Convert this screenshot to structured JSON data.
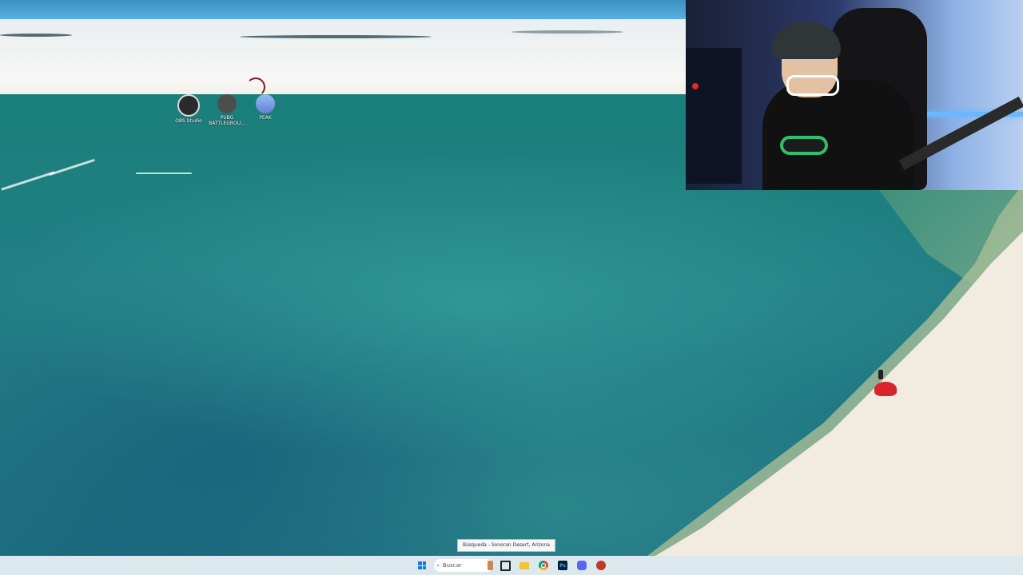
{
  "desktop": {
    "icons": [
      {
        "label": "OBS Studio",
        "icon": "obs-icon"
      },
      {
        "label": "PUBG BATTLEGROU...",
        "icon": "pubg-icon"
      },
      {
        "label": "PEAK",
        "icon": "peak-icon"
      }
    ]
  },
  "tooltip": {
    "text": "Búsqueda - Sonoran Desert, Arizona"
  },
  "taskbar": {
    "search_placeholder": "Buscar",
    "ps_label": "Ps",
    "items": [
      {
        "name": "start",
        "icon": "windows-start-icon"
      },
      {
        "name": "search",
        "icon": "search-icon"
      },
      {
        "name": "widgets",
        "icon": "widgets-icon"
      },
      {
        "name": "task-view",
        "icon": "task-view-icon"
      },
      {
        "name": "file-explorer",
        "icon": "folder-icon"
      },
      {
        "name": "chrome",
        "icon": "chrome-icon"
      },
      {
        "name": "photoshop",
        "icon": "photoshop-icon"
      },
      {
        "name": "discord",
        "icon": "discord-icon"
      },
      {
        "name": "app",
        "icon": "app-icon"
      }
    ]
  },
  "colors": {
    "taskbar_bg": "#dbe9ef",
    "accent": "#1c7ad8"
  }
}
